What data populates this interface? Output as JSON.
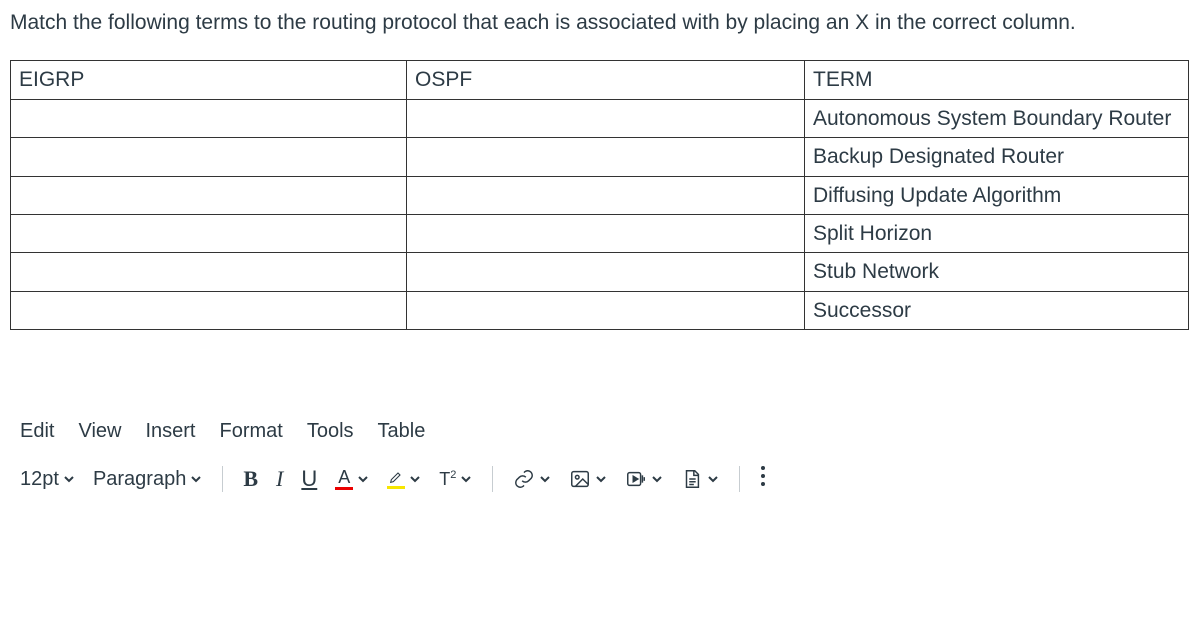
{
  "question": "Match the following terms to the routing protocol that each is associated with by placing an X in the correct column.",
  "table": {
    "headers": {
      "col1": "EIGRP",
      "col2": "OSPF",
      "col3": "TERM"
    },
    "rows": [
      {
        "eigrp": "",
        "ospf": "",
        "term": "Autonomous System Boundary Router"
      },
      {
        "eigrp": "",
        "ospf": "",
        "term": "Backup Designated Router"
      },
      {
        "eigrp": "",
        "ospf": "",
        "term": "Diffusing Update Algorithm"
      },
      {
        "eigrp": "",
        "ospf": "",
        "term": "Split Horizon"
      },
      {
        "eigrp": "",
        "ospf": "",
        "term": "Stub Network"
      },
      {
        "eigrp": "",
        "ospf": "",
        "term": "Successor"
      }
    ]
  },
  "editor": {
    "menubar": {
      "edit": "Edit",
      "view": "View",
      "insert": "Insert",
      "format": "Format",
      "tools": "Tools",
      "table": "Table"
    },
    "toolbar": {
      "font_size": "12pt",
      "block_format": "Paragraph",
      "bold": "B",
      "italic": "I",
      "underline": "U",
      "text_color_letter": "A",
      "superscript_label": "T",
      "superscript_exp": "2"
    }
  }
}
